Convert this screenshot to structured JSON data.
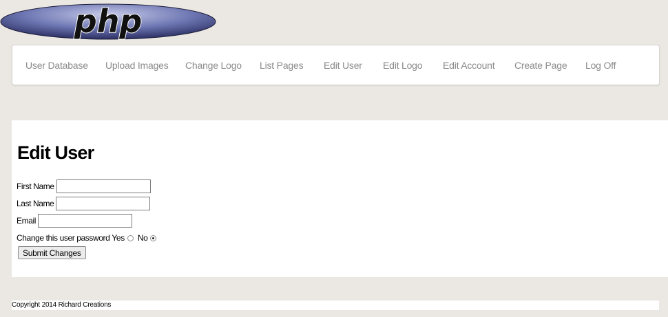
{
  "logo": {
    "text": "php"
  },
  "nav": {
    "items": [
      {
        "label": "User Database"
      },
      {
        "label": "Upload Images"
      },
      {
        "label": "Change Logo"
      },
      {
        "label": "List Pages"
      },
      {
        "label": "Edit User"
      },
      {
        "label": "Edit Logo"
      },
      {
        "label": "Edit Account"
      },
      {
        "label": "Create Page"
      },
      {
        "label": "Log Off"
      }
    ]
  },
  "main": {
    "title": "Edit User",
    "form": {
      "first_name_label": "First Name",
      "first_name_value": "",
      "last_name_label": "Last Name",
      "last_name_value": "",
      "email_label": "Email",
      "email_value": "",
      "password_label": "Change this user password",
      "yes_label": "Yes",
      "no_label": "No",
      "password_change_selected": "No",
      "submit_label": "Submit Changes"
    }
  },
  "footer": {
    "text": "Copyright 2014 Richard Creations"
  }
}
